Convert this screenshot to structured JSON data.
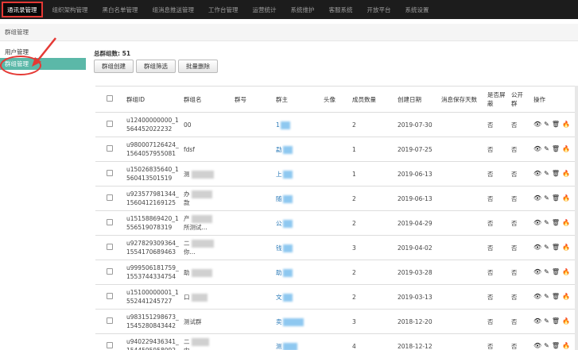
{
  "nav": {
    "items": [
      "通讯录管理",
      "组织架构管理",
      "黑白名单管理",
      "组消息推送管理",
      "工作台管理",
      "运营统计",
      "系统维护",
      "客服系统",
      "开放平台",
      "系统设置"
    ]
  },
  "breadcrumb": "群组管理",
  "sidebar": {
    "items": [
      "用户管理",
      "群组管理"
    ]
  },
  "main": {
    "count_label": "总群组数: 51",
    "buttons": [
      "群组创建",
      "群组筛选",
      "批量删除"
    ]
  },
  "table": {
    "headers": [
      "群组ID",
      "群组名",
      "群号",
      "群主",
      "头像",
      "成员数量",
      "创建日期",
      "消息保存天数",
      "是否屏蔽",
      "公开群",
      "操作"
    ],
    "rows": [
      {
        "id1": "u12400000000_1",
        "id2": "564452022232",
        "name1": "00",
        "name2": "",
        "owner": "1",
        "members": "2",
        "date": "2019-07-30",
        "blocked": "否",
        "public": "否"
      },
      {
        "id1": "u980007126424_",
        "id2": "1564057955081",
        "name1": "fdsf",
        "name2": "",
        "owner": "勐",
        "members": "1",
        "date": "2019-07-25",
        "blocked": "否",
        "public": "否"
      },
      {
        "id1": "u15026835640_1",
        "id2": "560413501519",
        "name1": "测",
        "name2": "",
        "owner": "上",
        "members": "1",
        "date": "2019-06-13",
        "blocked": "否",
        "public": "否"
      },
      {
        "id1": "u923577981344_",
        "id2": "1560412169125",
        "name1": "办",
        "name2": "款",
        "owner": "随",
        "members": "2",
        "date": "2019-06-13",
        "blocked": "否",
        "public": "否"
      },
      {
        "id1": "u15158869420_1",
        "id2": "556519078319",
        "name1": "产",
        "name2": "所测试...",
        "owner": "公",
        "members": "2",
        "date": "2019-04-29",
        "blocked": "否",
        "public": "否"
      },
      {
        "id1": "u927829309364_",
        "id2": "1554170689463",
        "name1": "二",
        "name2": "你...",
        "owner": "钱",
        "members": "3",
        "date": "2019-04-02",
        "blocked": "否",
        "public": "否"
      },
      {
        "id1": "u999506181759_",
        "id2": "1553744334754",
        "name1": "助",
        "name2": "",
        "owner": "助",
        "members": "2",
        "date": "2019-03-28",
        "blocked": "否",
        "public": "否"
      },
      {
        "id1": "u15100000001_1",
        "id2": "552441245727",
        "name1": "口",
        "name2": "",
        "owner": "文",
        "members": "2",
        "date": "2019-03-13",
        "blocked": "否",
        "public": "否"
      },
      {
        "id1": "u983151298673_",
        "id2": "1545280843442",
        "name1": "测试群",
        "name2": "",
        "owner": "卖",
        "members": "3",
        "date": "2018-12-20",
        "blocked": "否",
        "public": "否"
      },
      {
        "id1": "u940229436341_",
        "id2": "1544595958092",
        "name1": "二",
        "name2": "内",
        "owner": "测",
        "members": "4",
        "date": "2018-12-12",
        "blocked": "否",
        "public": "否"
      }
    ]
  },
  "icons": {
    "view": "eye-icon",
    "edit": "pencil-icon",
    "delete": "trash-icon",
    "fire": "flame-icon"
  },
  "colors": {
    "nav_bg": "#1c1c1c",
    "active_sidebar": "#5bb8a8",
    "highlight": "#e53935"
  }
}
